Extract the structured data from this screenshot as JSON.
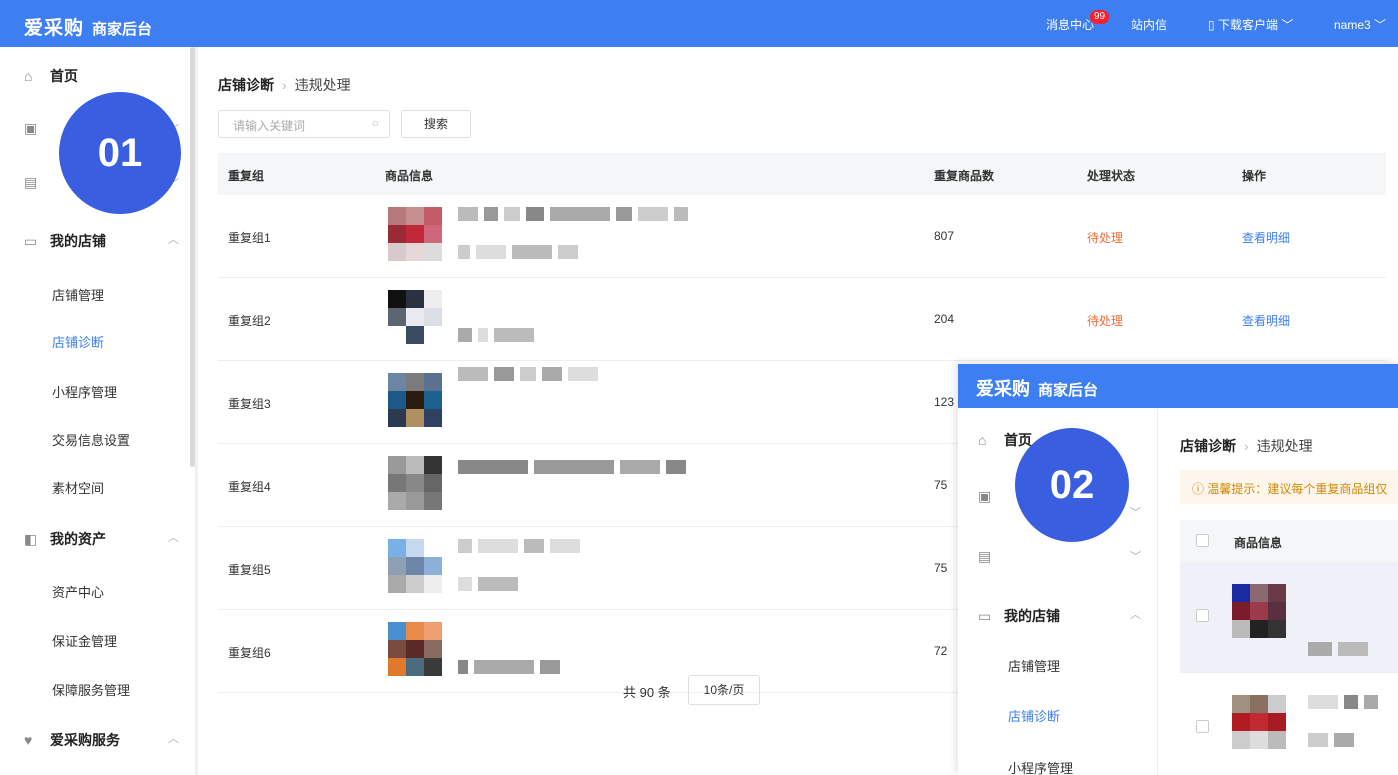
{
  "app": {
    "logo": "爱采购",
    "subtitle": "商家后台"
  },
  "topbar": {
    "messages": "消息中心",
    "message_badge": "99",
    "inbox": "站内信",
    "download": "下载客户端",
    "user": "name3"
  },
  "sidebar": {
    "home": "首页",
    "my_store": "我的店铺",
    "store_items": [
      "店铺管理",
      "店铺诊断",
      "小程序管理",
      "交易信息设置",
      "素材空间"
    ],
    "my_assets": "我的资产",
    "asset_items": [
      "资产中心",
      "保证金管理",
      "保障服务管理"
    ],
    "service": "爱采购服务"
  },
  "step_markers": [
    "01",
    "02"
  ],
  "breadcrumb": {
    "parent": "店铺诊断",
    "current": "违规处理"
  },
  "search": {
    "placeholder": "请输入关键词",
    "button": "搜索"
  },
  "table": {
    "headers": [
      "重复组",
      "商品信息",
      "重复商品数",
      "处理状态",
      "操作"
    ],
    "rows": [
      {
        "group": "重复组1",
        "count": "807",
        "status": "待处理",
        "action": "查看明细"
      },
      {
        "group": "重复组2",
        "count": "204",
        "status": "待处理",
        "action": "查看明细"
      },
      {
        "group": "重复组3",
        "count": "123"
      },
      {
        "group": "重复组4",
        "count": "75"
      },
      {
        "group": "重复组5",
        "count": "75"
      },
      {
        "group": "重复组6",
        "count": "72"
      }
    ]
  },
  "pagination": {
    "total": "共 90 条",
    "page_size": "10条/页"
  },
  "overlay": {
    "tip": "温馨提示：建议每个重复商品组仅",
    "col_product": "商品信息"
  },
  "colors": {
    "brand": "#3d7ff2",
    "pending": "#f26b3a",
    "marker": "#3a5ee0"
  }
}
